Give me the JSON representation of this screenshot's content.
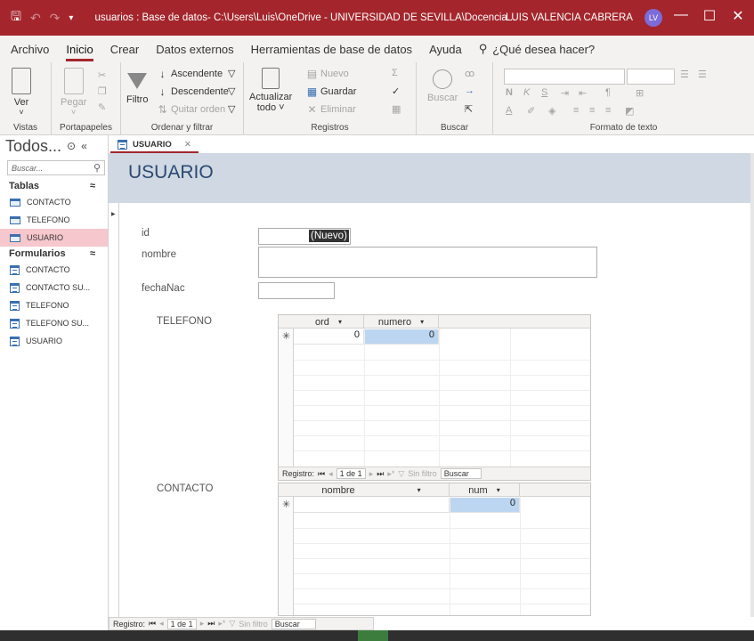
{
  "titlebar": {
    "title": "usuarios : Base de datos- C:\\Users\\Luis\\OneDrive - UNIVERSIDAD DE SEVILLA\\Docencia...",
    "user": "LUIS VALENCIA CABRERA",
    "avatar": "LV",
    "minimize": "—",
    "restore": "☐",
    "close": "✕"
  },
  "tabs": [
    "Archivo",
    "Inicio",
    "Crear",
    "Datos externos",
    "Herramientas de base de datos",
    "Ayuda"
  ],
  "tell_me": "¿Qué desea hacer?",
  "ribbon": {
    "vistas": {
      "ver": "Ver",
      "label": "Vistas"
    },
    "portapapeles": {
      "pegar": "Pegar",
      "label": "Portapapeles"
    },
    "ordenar": {
      "filtro": "Filtro",
      "ascendente": "Ascendente",
      "descendente": "Descendente",
      "quitar": "Quitar orden",
      "label": "Ordenar y filtrar"
    },
    "registros": {
      "actualizar": "Actualizar",
      "todo": "todo ˅",
      "nuevo": "Nuevo",
      "guardar": "Guardar",
      "eliminar": "Eliminar",
      "label": "Registros"
    },
    "buscar": {
      "buscar": "Buscar",
      "label": "Buscar"
    },
    "formato": {
      "bold": "N",
      "italic": "K",
      "underline": "S",
      "label": "Formato de texto"
    }
  },
  "nav": {
    "title": "Todos...",
    "search_placeholder": "Buscar...",
    "sections": [
      {
        "name": "Tablas",
        "items": [
          "CONTACTO",
          "TELEFONO",
          "USUARIO"
        ]
      },
      {
        "name": "Formularios",
        "items": [
          "CONTACTO",
          "CONTACTO Su...",
          "TELEFONO",
          "TELEFONO Su...",
          "USUARIO"
        ]
      }
    ]
  },
  "document": {
    "tab": "USUARIO",
    "form_title": "USUARIO",
    "fields": {
      "id_label": "id",
      "id_value": "(Nuevo)",
      "nombre_label": "nombre",
      "fecha_label": "fechaNac"
    },
    "telefono": {
      "label": "TELEFONO",
      "columns": [
        "ord",
        "numero"
      ],
      "new_row": [
        "0",
        "0"
      ]
    },
    "contacto": {
      "label": "CONTACTO",
      "columns": [
        "nombre",
        "num"
      ],
      "new_row": [
        "",
        "0"
      ]
    },
    "record_nav": {
      "prefix": "Registro:",
      "position": "1 de 1",
      "no_filter": "Sin filtro",
      "search": "Buscar"
    }
  }
}
